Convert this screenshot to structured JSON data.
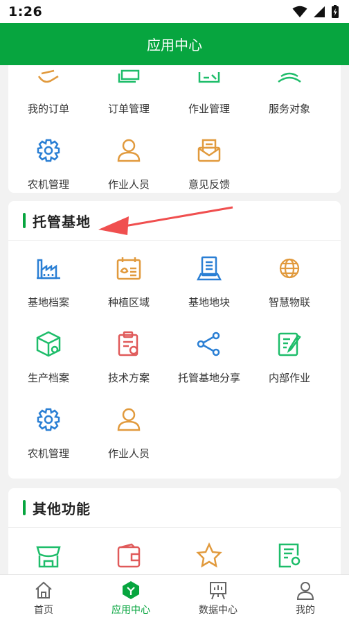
{
  "status_bar": {
    "time": "1:26"
  },
  "header": {
    "title": "应用中心"
  },
  "top_card": {
    "items": [
      {
        "label": "我的订单",
        "icon": "order-icon"
      },
      {
        "label": "订单管理",
        "icon": "order-manage-icon"
      },
      {
        "label": "作业管理",
        "icon": "work-manage-icon"
      },
      {
        "label": "服务对象",
        "icon": "service-object-icon"
      },
      {
        "label": "农机管理",
        "icon": "gear-icon"
      },
      {
        "label": "作业人员",
        "icon": "person-icon"
      },
      {
        "label": "意见反馈",
        "icon": "feedback-icon"
      }
    ]
  },
  "hosting_card": {
    "title": "托管基地",
    "items": [
      {
        "label": "基地档案",
        "icon": "factory-icon"
      },
      {
        "label": "种植区域",
        "icon": "calendar-plant-icon"
      },
      {
        "label": "基地地块",
        "icon": "document-stand-icon"
      },
      {
        "label": "智慧物联",
        "icon": "globe-icon"
      },
      {
        "label": "生产档案",
        "icon": "box-gear-icon"
      },
      {
        "label": "技术方案",
        "icon": "clipboard-gear-icon"
      },
      {
        "label": "托管基地分享",
        "icon": "share-icon"
      },
      {
        "label": "内部作业",
        "icon": "edit-icon"
      },
      {
        "label": "农机管理",
        "icon": "gear-icon"
      },
      {
        "label": "作业人员",
        "icon": "person-icon"
      }
    ]
  },
  "other_card": {
    "title": "其他功能",
    "items": [
      {
        "label": "",
        "icon": "store-icon"
      },
      {
        "label": "",
        "icon": "wallet-icon"
      },
      {
        "label": "",
        "icon": "star-icon"
      },
      {
        "label": "",
        "icon": "certificate-icon"
      }
    ]
  },
  "tabbar": {
    "tabs": [
      {
        "label": "首页",
        "icon": "home-icon"
      },
      {
        "label": "应用中心",
        "icon": "app-center-icon"
      },
      {
        "label": "数据中心",
        "icon": "data-board-icon"
      },
      {
        "label": "我的",
        "icon": "profile-icon"
      }
    ]
  },
  "colors": {
    "primary": "#07a53f",
    "blue": "#2a7fd4",
    "orange": "#e19a3d",
    "red": "#e05a5a",
    "green": "#1ebd6a"
  }
}
